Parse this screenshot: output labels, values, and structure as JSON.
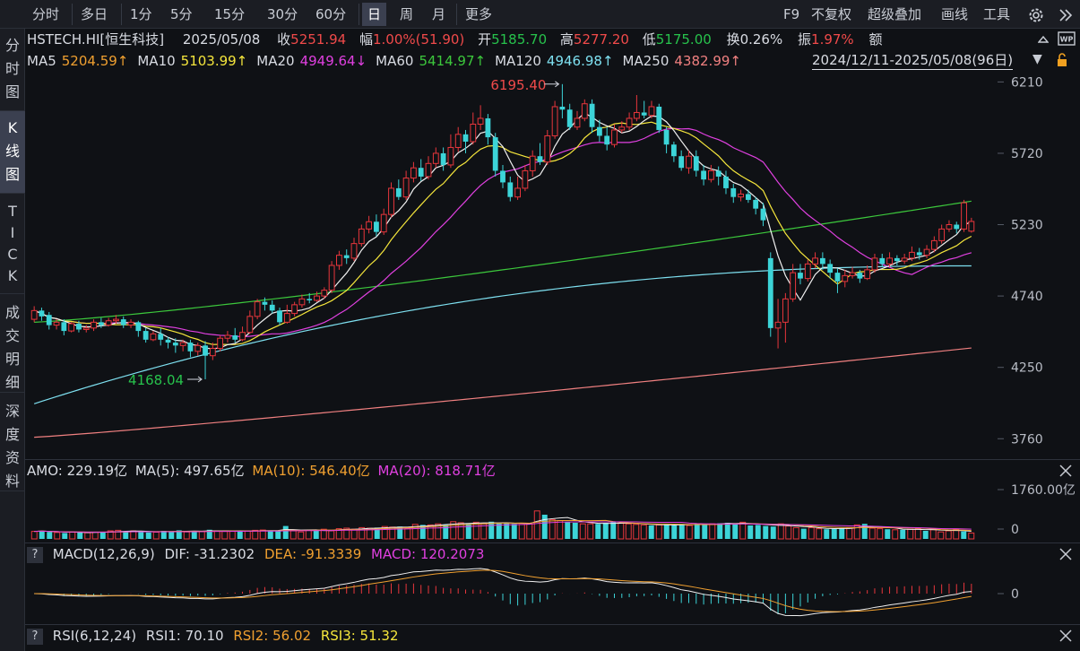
{
  "toolbar": {
    "timeframes": [
      "分时",
      "多日",
      "1分",
      "5分",
      "15分",
      "30分",
      "60分",
      "日",
      "周",
      "月",
      "更多"
    ],
    "active_timeframe": "日",
    "right_items": [
      "F9",
      "不复权",
      "超级叠加",
      "画线",
      "工具"
    ]
  },
  "sidebar": {
    "tabs": [
      {
        "label": "分时图",
        "chars": [
          "分",
          "时",
          "图"
        ]
      },
      {
        "label": "K线图",
        "chars": [
          "K",
          "线",
          "图"
        ]
      },
      {
        "label": "TICK",
        "chars": [
          "T",
          "I",
          "C",
          "K"
        ]
      },
      {
        "label": "成交明细",
        "chars": [
          "成",
          "交",
          "明",
          "细"
        ]
      },
      {
        "label": "深度资料",
        "chars": [
          "深",
          "度",
          "资",
          "料"
        ]
      }
    ],
    "active": "K线图"
  },
  "quote": {
    "symbol": "HSTECH.HI[恒生科技]",
    "date": "2025/05/08",
    "close_label": "收",
    "close": "5251.94",
    "change_label": "幅",
    "change": "1.00%(51.90)",
    "open_label": "开",
    "open": "5185.70",
    "high_label": "高",
    "high": "5277.20",
    "low_label": "低",
    "low": "5175.00",
    "turnover_label": "换",
    "turnover": "0.26%",
    "amplitude_label": "振",
    "amplitude": "1.97%",
    "amount_label": "额"
  },
  "ma_row": {
    "items": [
      {
        "label": "MA5",
        "value": "5204.59↑",
        "color": "#f0a030"
      },
      {
        "label": "MA10",
        "value": "5103.99↑",
        "color": "#f5e63c"
      },
      {
        "label": "MA20",
        "value": "4949.64↓",
        "color": "#e040e0"
      },
      {
        "label": "MA60",
        "value": "5414.97↑",
        "color": "#3cc83c"
      },
      {
        "label": "MA120",
        "value": "4946.98↑",
        "color": "#7ee0f0"
      },
      {
        "label": "MA250",
        "value": "4382.99↑",
        "color": "#f08080"
      }
    ],
    "range": "2024/12/11-2025/05/08(96日)"
  },
  "amo_row": {
    "amo": "AMO: 229.19亿",
    "ma5": "MA(5): 497.65亿",
    "ma10": "MA(10): 546.40亿",
    "ma20": "MA(20): 818.71亿"
  },
  "macd_row": {
    "q": "?",
    "title": "MACD(12,26,9)",
    "dif": "DIF: -31.2302",
    "dea": "DEA: -91.3339",
    "macd": "MACD: 120.2073"
  },
  "rsi_row": {
    "q": "?",
    "title": "RSI(6,12,24)",
    "rsi1": "RSI1: 70.10",
    "rsi2": "RSI2: 56.02",
    "rsi3": "RSI3: 51.32"
  },
  "colors": {
    "up": "#e8363c",
    "down": "#3cd4d8",
    "ma5": "#f0f0f0",
    "ma10": "#f5e63c",
    "ma20": "#e040e0",
    "ma60": "#3cc83c",
    "ma120": "#7ee0f0",
    "ma250": "#f08080"
  },
  "chart_data": [
    {
      "type": "candlestick",
      "title": "HSTECH.HI[恒生科技]",
      "y_ticks": [
        "6210",
        "5720",
        "5230",
        "4740",
        "4250",
        "3760"
      ],
      "ylim": [
        3620,
        6280
      ],
      "annotations": [
        {
          "text": "6195.40",
          "kind": "high"
        },
        {
          "text": "4168.04",
          "kind": "low"
        }
      ],
      "candles": [
        {
          "o": 4580,
          "c": 4640,
          "h": 4670,
          "l": 4560
        },
        {
          "o": 4640,
          "c": 4600,
          "h": 4660,
          "l": 4570
        },
        {
          "o": 4610,
          "c": 4540,
          "h": 4630,
          "l": 4510
        },
        {
          "o": 4540,
          "c": 4560,
          "h": 4580,
          "l": 4510
        },
        {
          "o": 4560,
          "c": 4500,
          "h": 4580,
          "l": 4470
        },
        {
          "o": 4500,
          "c": 4550,
          "h": 4560,
          "l": 4490
        },
        {
          "o": 4550,
          "c": 4510,
          "h": 4570,
          "l": 4490
        },
        {
          "o": 4510,
          "c": 4520,
          "h": 4540,
          "l": 4490
        },
        {
          "o": 4520,
          "c": 4560,
          "h": 4580,
          "l": 4500
        },
        {
          "o": 4560,
          "c": 4540,
          "h": 4590,
          "l": 4520
        },
        {
          "o": 4540,
          "c": 4570,
          "h": 4590,
          "l": 4530
        },
        {
          "o": 4570,
          "c": 4580,
          "h": 4610,
          "l": 4550
        },
        {
          "o": 4580,
          "c": 4540,
          "h": 4600,
          "l": 4520
        },
        {
          "o": 4540,
          "c": 4560,
          "h": 4580,
          "l": 4520
        },
        {
          "o": 4560,
          "c": 4500,
          "h": 4570,
          "l": 4460
        },
        {
          "o": 4500,
          "c": 4440,
          "h": 4520,
          "l": 4420
        },
        {
          "o": 4440,
          "c": 4480,
          "h": 4500,
          "l": 4430
        },
        {
          "o": 4480,
          "c": 4440,
          "h": 4520,
          "l": 4400
        },
        {
          "o": 4440,
          "c": 4420,
          "h": 4460,
          "l": 4380
        },
        {
          "o": 4420,
          "c": 4400,
          "h": 4450,
          "l": 4350
        },
        {
          "o": 4400,
          "c": 4420,
          "h": 4440,
          "l": 4360
        },
        {
          "o": 4420,
          "c": 4360,
          "h": 4440,
          "l": 4320
        },
        {
          "o": 4360,
          "c": 4400,
          "h": 4420,
          "l": 4330
        },
        {
          "o": 4400,
          "c": 4330,
          "h": 4430,
          "l": 4168
        },
        {
          "o": 4330,
          "c": 4380,
          "h": 4420,
          "l": 4300
        },
        {
          "o": 4380,
          "c": 4450,
          "h": 4470,
          "l": 4360
        },
        {
          "o": 4450,
          "c": 4470,
          "h": 4500,
          "l": 4420
        },
        {
          "o": 4470,
          "c": 4440,
          "h": 4520,
          "l": 4420
        },
        {
          "o": 4440,
          "c": 4490,
          "h": 4530,
          "l": 4430
        },
        {
          "o": 4490,
          "c": 4600,
          "h": 4640,
          "l": 4480
        },
        {
          "o": 4600,
          "c": 4700,
          "h": 4720,
          "l": 4580
        },
        {
          "o": 4700,
          "c": 4680,
          "h": 4730,
          "l": 4640
        },
        {
          "o": 4680,
          "c": 4640,
          "h": 4710,
          "l": 4620
        },
        {
          "o": 4640,
          "c": 4560,
          "h": 4660,
          "l": 4540
        },
        {
          "o": 4560,
          "c": 4620,
          "h": 4680,
          "l": 4550
        },
        {
          "o": 4620,
          "c": 4680,
          "h": 4700,
          "l": 4600
        },
        {
          "o": 4680,
          "c": 4720,
          "h": 4750,
          "l": 4660
        },
        {
          "o": 4720,
          "c": 4710,
          "h": 4760,
          "l": 4690
        },
        {
          "o": 4710,
          "c": 4740,
          "h": 4770,
          "l": 4700
        },
        {
          "o": 4740,
          "c": 4780,
          "h": 4800,
          "l": 4720
        },
        {
          "o": 4780,
          "c": 4950,
          "h": 4980,
          "l": 4760
        },
        {
          "o": 4950,
          "c": 5020,
          "h": 5050,
          "l": 4920
        },
        {
          "o": 5020,
          "c": 5000,
          "h": 5060,
          "l": 4960
        },
        {
          "o": 5000,
          "c": 5100,
          "h": 5140,
          "l": 4980
        },
        {
          "o": 5100,
          "c": 5200,
          "h": 5230,
          "l": 5080
        },
        {
          "o": 5200,
          "c": 5250,
          "h": 5290,
          "l": 5170
        },
        {
          "o": 5250,
          "c": 5180,
          "h": 5300,
          "l": 5150
        },
        {
          "o": 5180,
          "c": 5300,
          "h": 5340,
          "l": 5160
        },
        {
          "o": 5300,
          "c": 5480,
          "h": 5520,
          "l": 5280
        },
        {
          "o": 5480,
          "c": 5420,
          "h": 5540,
          "l": 5400
        },
        {
          "o": 5420,
          "c": 5550,
          "h": 5600,
          "l": 5400
        },
        {
          "o": 5550,
          "c": 5620,
          "h": 5660,
          "l": 5520
        },
        {
          "o": 5620,
          "c": 5560,
          "h": 5680,
          "l": 5530
        },
        {
          "o": 5560,
          "c": 5650,
          "h": 5700,
          "l": 5540
        },
        {
          "o": 5650,
          "c": 5720,
          "h": 5760,
          "l": 5620
        },
        {
          "o": 5720,
          "c": 5640,
          "h": 5760,
          "l": 5600
        },
        {
          "o": 5640,
          "c": 5760,
          "h": 5850,
          "l": 5620
        },
        {
          "o": 5760,
          "c": 5850,
          "h": 5900,
          "l": 5730
        },
        {
          "o": 5850,
          "c": 5800,
          "h": 5880,
          "l": 5720
        },
        {
          "o": 5800,
          "c": 5920,
          "h": 6000,
          "l": 5780
        },
        {
          "o": 5920,
          "c": 5960,
          "h": 6050,
          "l": 5880
        },
        {
          "o": 5960,
          "c": 5830,
          "h": 5990,
          "l": 5780
        },
        {
          "o": 5830,
          "c": 5600,
          "h": 5860,
          "l": 5560
        },
        {
          "o": 5600,
          "c": 5520,
          "h": 5640,
          "l": 5480
        },
        {
          "o": 5520,
          "c": 5420,
          "h": 5560,
          "l": 5390
        },
        {
          "o": 5420,
          "c": 5480,
          "h": 5560,
          "l": 5400
        },
        {
          "o": 5480,
          "c": 5600,
          "h": 5640,
          "l": 5460
        },
        {
          "o": 5600,
          "c": 5700,
          "h": 5740,
          "l": 5560
        },
        {
          "o": 5700,
          "c": 5660,
          "h": 5790,
          "l": 5640
        },
        {
          "o": 5660,
          "c": 5840,
          "h": 5880,
          "l": 5640
        },
        {
          "o": 5840,
          "c": 6040,
          "h": 6080,
          "l": 5820
        },
        {
          "o": 6040,
          "c": 6020,
          "h": 6195,
          "l": 5960
        },
        {
          "o": 6020,
          "c": 5900,
          "h": 6060,
          "l": 5880
        },
        {
          "o": 5900,
          "c": 5960,
          "h": 6010,
          "l": 5880
        },
        {
          "o": 5960,
          "c": 6060,
          "h": 6090,
          "l": 5940
        },
        {
          "o": 6060,
          "c": 5900,
          "h": 6090,
          "l": 5860
        },
        {
          "o": 5900,
          "c": 5840,
          "h": 5950,
          "l": 5800
        },
        {
          "o": 5840,
          "c": 5780,
          "h": 5900,
          "l": 5740
        },
        {
          "o": 5780,
          "c": 5880,
          "h": 5920,
          "l": 5760
        },
        {
          "o": 5880,
          "c": 5900,
          "h": 5940,
          "l": 5860
        },
        {
          "o": 5900,
          "c": 5960,
          "h": 6000,
          "l": 5880
        },
        {
          "o": 5960,
          "c": 6000,
          "h": 6120,
          "l": 5940
        },
        {
          "o": 6000,
          "c": 5980,
          "h": 6080,
          "l": 5960
        },
        {
          "o": 5980,
          "c": 6040,
          "h": 6080,
          "l": 5960
        },
        {
          "o": 6040,
          "c": 5880,
          "h": 6060,
          "l": 5860
        }
      ],
      "candles_tail": [
        {
          "o": 5880,
          "c": 5780,
          "h": 5900,
          "l": 5720
        },
        {
          "o": 5780,
          "c": 5700,
          "h": 5800,
          "l": 5660
        },
        {
          "o": 5700,
          "c": 5620,
          "h": 5740,
          "l": 5600
        },
        {
          "o": 5620,
          "c": 5700,
          "h": 5740,
          "l": 5580
        },
        {
          "o": 5700,
          "c": 5600,
          "h": 5740,
          "l": 5560
        },
        {
          "o": 5600,
          "c": 5540,
          "h": 5640,
          "l": 5500
        },
        {
          "o": 5540,
          "c": 5600,
          "h": 5640,
          "l": 5520
        },
        {
          "o": 5600,
          "c": 5560,
          "h": 5630,
          "l": 5500
        },
        {
          "o": 5560,
          "c": 5480,
          "h": 5600,
          "l": 5440
        },
        {
          "o": 5480,
          "c": 5420,
          "h": 5510,
          "l": 5380
        },
        {
          "o": 5420,
          "c": 5440,
          "h": 5470,
          "l": 5390
        },
        {
          "o": 5440,
          "c": 5400,
          "h": 5470,
          "l": 5380
        },
        {
          "o": 5400,
          "c": 5340,
          "h": 5420,
          "l": 5300
        },
        {
          "o": 5340,
          "c": 5260,
          "h": 5380,
          "l": 5220
        },
        {
          "o": 5000,
          "c": 4520,
          "h": 5040,
          "l": 4460
        },
        {
          "o": 4520,
          "c": 4560,
          "h": 4720,
          "l": 4380
        },
        {
          "o": 4560,
          "c": 4720,
          "h": 4760,
          "l": 4420
        },
        {
          "o": 4720,
          "c": 4900,
          "h": 4960,
          "l": 4700
        },
        {
          "o": 4900,
          "c": 4860,
          "h": 4960,
          "l": 4820
        },
        {
          "o": 4860,
          "c": 4960,
          "h": 4990,
          "l": 4840
        },
        {
          "o": 4960,
          "c": 5000,
          "h": 5040,
          "l": 4930
        },
        {
          "o": 5000,
          "c": 4960,
          "h": 5040,
          "l": 4920
        },
        {
          "o": 4960,
          "c": 4900,
          "h": 4990,
          "l": 4860
        },
        {
          "o": 4900,
          "c": 4840,
          "h": 4930,
          "l": 4760
        },
        {
          "o": 4840,
          "c": 4880,
          "h": 4920,
          "l": 4800
        },
        {
          "o": 4880,
          "c": 4900,
          "h": 4940,
          "l": 4860
        },
        {
          "o": 4900,
          "c": 4860,
          "h": 4920,
          "l": 4830
        },
        {
          "o": 4860,
          "c": 4920,
          "h": 4950,
          "l": 4850
        },
        {
          "o": 4920,
          "c": 5000,
          "h": 5030,
          "l": 4900
        },
        {
          "o": 5000,
          "c": 4960,
          "h": 5030,
          "l": 4940
        },
        {
          "o": 4960,
          "c": 5000,
          "h": 5040,
          "l": 4940
        },
        {
          "o": 5000,
          "c": 4980,
          "h": 5020,
          "l": 4950
        },
        {
          "o": 4980,
          "c": 5000,
          "h": 5030,
          "l": 4960
        },
        {
          "o": 5000,
          "c": 5040,
          "h": 5080,
          "l": 4980
        },
        {
          "o": 5040,
          "c": 5020,
          "h": 5070,
          "l": 4990
        },
        {
          "o": 5020,
          "c": 5060,
          "h": 5090,
          "l": 5000
        },
        {
          "o": 5060,
          "c": 5120,
          "h": 5150,
          "l": 5040
        },
        {
          "o": 5120,
          "c": 5200,
          "h": 5230,
          "l": 5100
        },
        {
          "o": 5200,
          "c": 5230,
          "h": 5260,
          "l": 5180
        },
        {
          "o": 5230,
          "c": 5200,
          "h": 5250,
          "l": 5170
        },
        {
          "o": 5200,
          "c": 5380,
          "h": 5400,
          "l": 5180
        },
        {
          "o": 5185,
          "c": 5252,
          "h": 5277,
          "l": 5175
        }
      ]
    },
    {
      "type": "bar",
      "title": "AMO",
      "y_ticks": [
        "1760.00亿",
        "0"
      ],
      "ylim": [
        0,
        2000
      ],
      "values": [
        280,
        300,
        260,
        240,
        220,
        260,
        240,
        230,
        250,
        260,
        300,
        320,
        280,
        300,
        260,
        240,
        250,
        300,
        280,
        320,
        260,
        300,
        280,
        340,
        300,
        280,
        280,
        290,
        300,
        320,
        330,
        300,
        310,
        480,
        300,
        260,
        320,
        330,
        360,
        300,
        380,
        400,
        360,
        420,
        400,
        420,
        460,
        440,
        460,
        400,
        540,
        520,
        520,
        560,
        520,
        640,
        600,
        560,
        620,
        560,
        640,
        600,
        580,
        560,
        540,
        560,
        1040,
        900,
        720,
        680,
        640,
        600,
        560,
        560,
        560,
        600,
        620,
        580,
        560,
        540,
        520,
        500,
        520,
        540,
        500,
        560,
        500,
        580,
        560,
        560,
        580,
        600,
        560,
        620,
        500,
        520,
        480,
        460,
        560,
        480,
        420,
        380,
        420,
        380,
        360,
        380,
        400,
        420,
        520,
        560,
        400,
        380,
        360,
        340,
        340,
        360,
        380,
        300,
        340,
        260,
        300,
        360,
        280,
        220
      ]
    },
    {
      "type": "line",
      "title": "MACD(12,26,9)",
      "y_ticks": [
        "0"
      ],
      "ylim": [
        -200,
        200
      ]
    },
    {
      "type": "line",
      "title": "RSI(6,12,24)"
    }
  ]
}
